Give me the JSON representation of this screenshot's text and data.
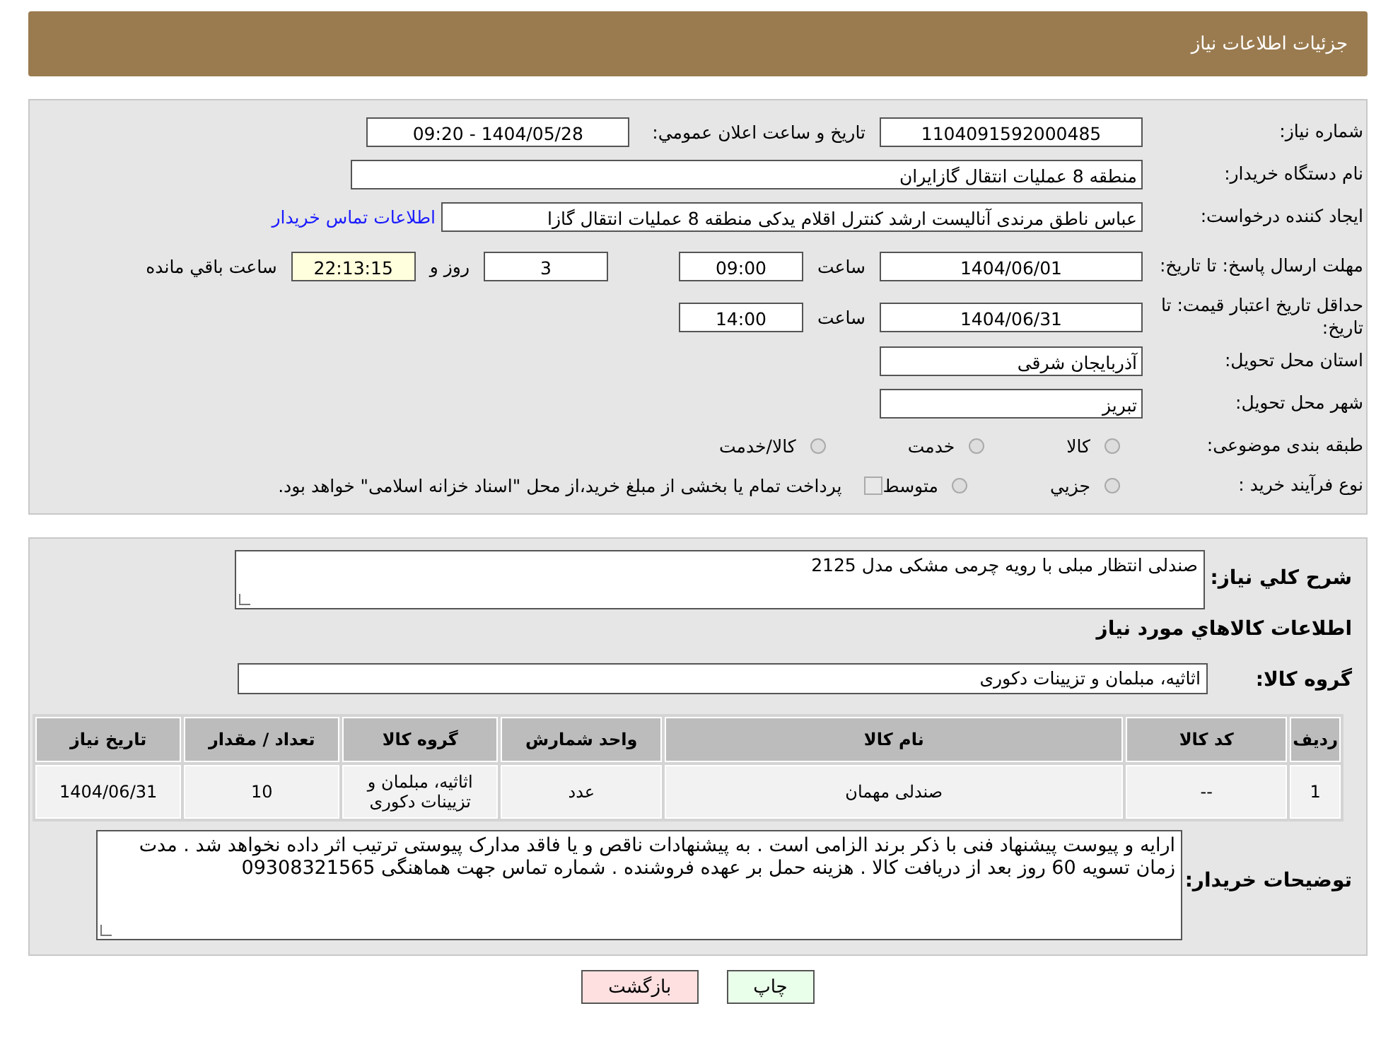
{
  "header": {
    "title": "جزئیات اطلاعات نیاز"
  },
  "need_number": {
    "label": "شماره نیاز:",
    "value": "1104091592000485"
  },
  "announce": {
    "label": "تاريخ و ساعت اعلان عمومي:",
    "value": "1404/05/28 - 09:20"
  },
  "buyer_org": {
    "label": "نام دستگاه خریدار:",
    "value": "منطقه 8 عملیات انتقال گازایران"
  },
  "requester": {
    "label": "ایجاد کننده درخواست:",
    "value": "عباس ناطق مرندی آنالیست ارشد کنترل اقلام یدکی منطقه 8 عملیات انتقال گازا",
    "link": "اطلاعات تماس خریدار"
  },
  "response_deadline": {
    "label": "مهلت ارسال پاسخ: تا تاریخ:",
    "date": "1404/06/01",
    "time_label": "ساعت",
    "time": "09:00",
    "days": "3",
    "days_label": "روز و",
    "remaining": "22:13:15",
    "remaining_label": "ساعت باقي مانده"
  },
  "price_validity": {
    "label": "حداقل تاریخ اعتبار قیمت: تا تاریخ:",
    "date": "1404/06/31",
    "time_label": "ساعت",
    "time": "14:00"
  },
  "province": {
    "label": "استان محل تحویل:",
    "value": "آذربایجان شرقی"
  },
  "city": {
    "label": "شهر محل تحویل:",
    "value": "تبریز"
  },
  "category": {
    "label": "طبقه بندی موضوعی:",
    "options": [
      {
        "label": "کالا",
        "selected": false
      },
      {
        "label": "خدمت",
        "selected": false
      },
      {
        "label": "کالا/خدمت",
        "selected": false
      }
    ]
  },
  "purchase_type": {
    "label": "نوع فرآیند خرید :",
    "options": [
      {
        "label": "جزيي",
        "selected": false
      },
      {
        "label": "متوسط",
        "selected": false
      }
    ],
    "note_checked": false,
    "note": "پرداخت تمام یا بخشی از مبلغ خرید،از محل \"اسناد خزانه اسلامی\" خواهد بود."
  },
  "description": {
    "label": "شرح كلي نياز:",
    "value": "صندلی انتظار مبلی با رویه چرمی مشکی مدل 2125"
  },
  "items_heading": "اطلاعات كالاهاي مورد نياز",
  "goods_group": {
    "label": "گروه کالا:",
    "value": "اثاثیه، مبلمان و تزیینات دکوری"
  },
  "table": {
    "columns": [
      "ردیف",
      "کد کالا",
      "نام کالا",
      "واحد شمارش",
      "گروه کالا",
      "تعداد / مقدار",
      "تاریخ نیاز"
    ],
    "rows": [
      [
        "1",
        "--",
        "صندلی مهمان",
        "عدد",
        "اثاثیه، مبلمان و تزیینات دکوری",
        "10",
        "1404/06/31"
      ]
    ]
  },
  "buyer_notes": {
    "label": "توضیحات خریدار:",
    "value": "ارایه و پیوست پیشنهاد فنی با ذکر برند الزامی است . به پیشنهادات ناقص و یا فاقد مدارک پیوستی ترتیب اثر داده نخواهد شد . مدت زمان تسویه 60 روز بعد از دریافت کالا . هزینه حمل بر عهده فروشنده . شماره تماس جهت هماهنگی 09308321565"
  },
  "buttons": [
    {
      "kind": "print",
      "label": "چاپ"
    },
    {
      "kind": "back",
      "label": "بازگشت"
    }
  ]
}
